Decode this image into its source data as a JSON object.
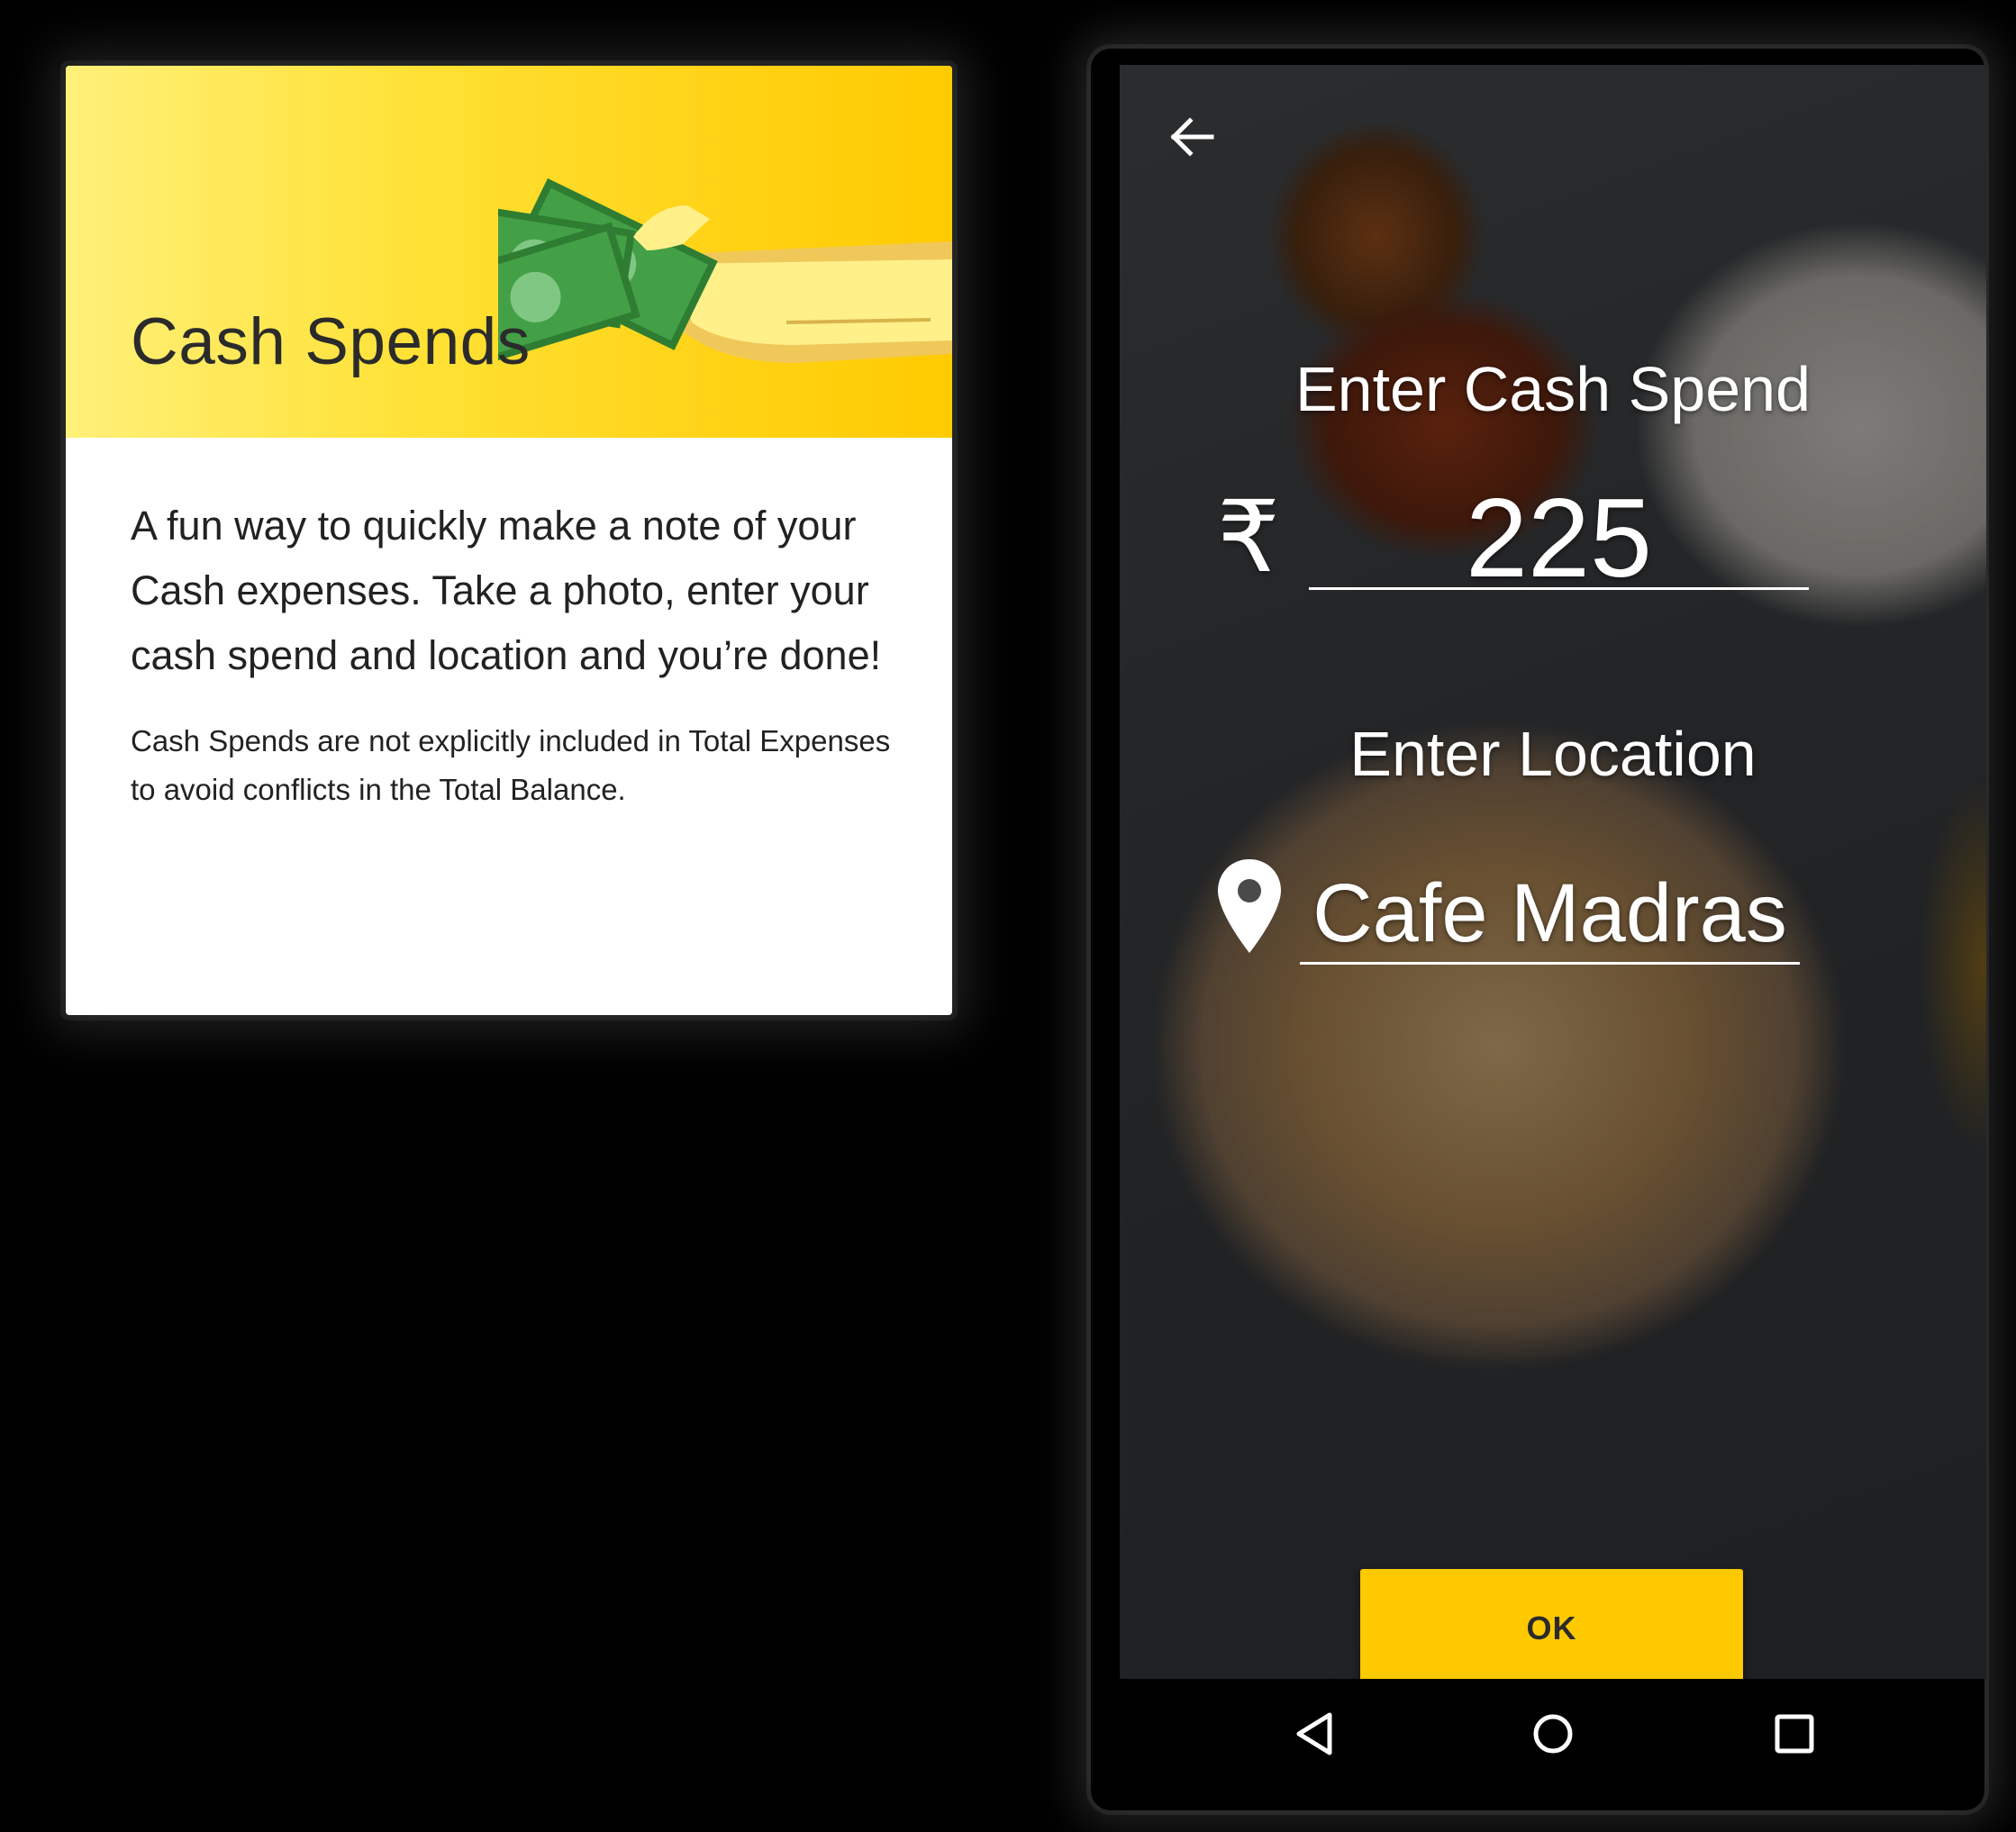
{
  "card": {
    "title": "Cash Spends",
    "description": "A fun way to quickly make a note of your Cash expenses. Take a photo, enter your cash spend and location and you’re done!",
    "note": "Cash Spends are not explicitly included in Total Expenses to avoid conflicts in the Total Balance.",
    "illustration_icon": "cash-in-hand-icon",
    "header_colors": [
      "#fff07a",
      "#ffcb00"
    ]
  },
  "phone": {
    "back_icon": "arrow-left-icon",
    "spend_heading": "Enter Cash Spend",
    "currency_symbol": "₹",
    "amount": "225",
    "location_heading": "Enter Location",
    "location_icon": "location-pin-icon",
    "location": "Cafe Madras",
    "ok_label": "OK",
    "accent_color": "#ffc900",
    "nav": {
      "back_icon": "triangle-back-icon",
      "home_icon": "circle-home-icon",
      "recent_icon": "square-recents-icon"
    }
  }
}
